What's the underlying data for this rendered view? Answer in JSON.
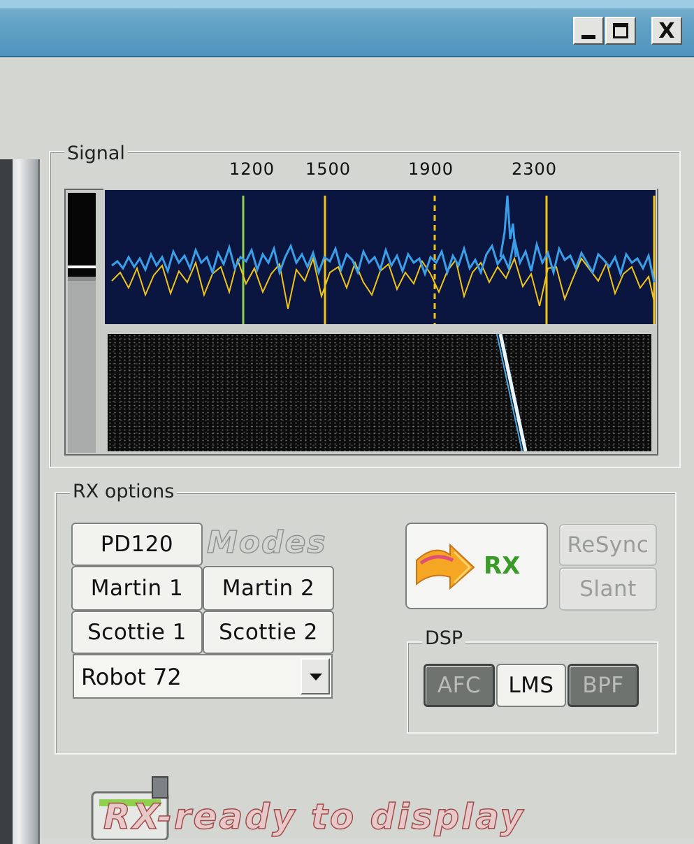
{
  "window": {
    "controls": {
      "minimize_icon": "minimize-icon",
      "maximize_icon": "maximize-icon",
      "close_icon": "close-icon",
      "close_label": "X"
    }
  },
  "signal": {
    "group_label": "Signal",
    "frequency_markers": [
      "1200",
      "1500",
      "1900",
      "2300"
    ]
  },
  "rx_options": {
    "group_label": "RX options",
    "modes_label": "Modes",
    "mode_buttons": {
      "pd120": "PD120",
      "martin1": "Martin 1",
      "martin2": "Martin 2",
      "scottie1": "Scottie 1",
      "scottie2": "Scottie 2"
    },
    "mode_select_value": "Robot 72",
    "rx_button_label": "RX",
    "resync_label": "ReSync",
    "slant_label": "Slant"
  },
  "dsp": {
    "group_label": "DSP",
    "afc_label": "AFC",
    "lms_label": "LMS",
    "bpf_label": "BPF"
  },
  "footer": {
    "status_text": "RX-ready to display"
  },
  "colors": {
    "spectrum_background": "#0a1540",
    "spectrum_trace": "#3a9ee8",
    "marker_yellow": "#f0c419",
    "marker_green": "#8fd14f",
    "rx_label": "#3b9b2a"
  }
}
